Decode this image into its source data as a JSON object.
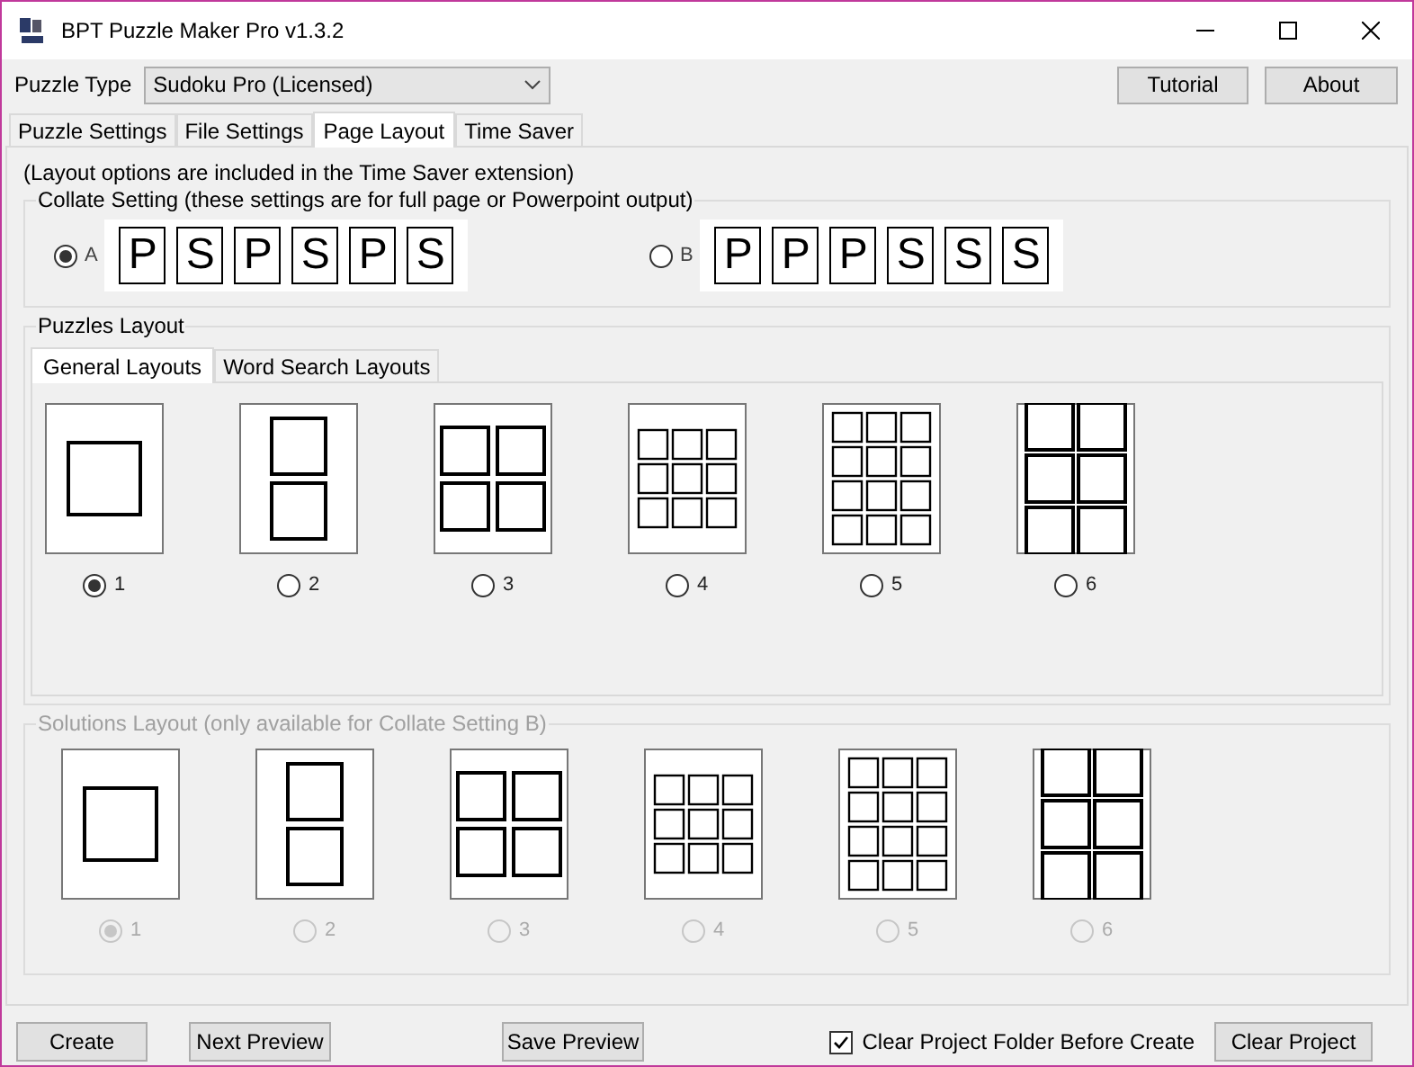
{
  "window": {
    "title": "BPT Puzzle Maker Pro v1.3.2"
  },
  "puzzle_type": {
    "label": "Puzzle Type",
    "value": "Sudoku Pro (Licensed)"
  },
  "top_buttons": [
    "Tutorial",
    "About"
  ],
  "tabs": [
    {
      "label": "Puzzle Settings",
      "selected": false
    },
    {
      "label": "File Settings",
      "selected": false
    },
    {
      "label": "Page Layout",
      "selected": true
    },
    {
      "label": "Time Saver",
      "selected": false
    }
  ],
  "note": "(Layout options are included in the Time Saver extension)",
  "collate": {
    "title": "Collate Setting (these settings are for full page or Powerpoint output)",
    "options": [
      {
        "label": "A",
        "selected": true,
        "pages": [
          "P",
          "S",
          "P",
          "S",
          "P",
          "S"
        ]
      },
      {
        "label": "B",
        "selected": false,
        "pages": [
          "P",
          "P",
          "P",
          "S",
          "S",
          "S"
        ]
      }
    ]
  },
  "puzzles_layout": {
    "title": "Puzzles Layout",
    "tabs": [
      {
        "label": "General Layouts",
        "selected": true
      },
      {
        "label": "Word Search Layouts",
        "selected": false
      }
    ],
    "layouts": [
      {
        "kind": "single",
        "label": "1",
        "selected": true
      },
      {
        "kind": "two",
        "label": "2",
        "selected": false
      },
      {
        "kind": "four",
        "label": "3",
        "selected": false
      },
      {
        "kind": "nine",
        "label": "4",
        "selected": false
      },
      {
        "kind": "twelve",
        "label": "5",
        "selected": false
      },
      {
        "kind": "six",
        "label": "6",
        "selected": false
      }
    ]
  },
  "solutions_layout": {
    "title": "Solutions Layout (only available for Collate Setting B)",
    "disabled": true,
    "layouts": [
      {
        "kind": "single",
        "label": "1",
        "selected": true
      },
      {
        "kind": "two",
        "label": "2",
        "selected": false
      },
      {
        "kind": "four",
        "label": "3",
        "selected": false
      },
      {
        "kind": "nine",
        "label": "4",
        "selected": false
      },
      {
        "kind": "twelve",
        "label": "5",
        "selected": false
      },
      {
        "kind": "six",
        "label": "6",
        "selected": false
      }
    ]
  },
  "bottom": {
    "buttons": [
      "Create",
      "Next Preview",
      "Save Preview"
    ],
    "checkbox": {
      "label": "Clear Project Folder Before Create",
      "checked": true
    },
    "clear_button": "Clear Project"
  }
}
